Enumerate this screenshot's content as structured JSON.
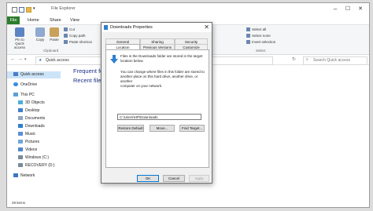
{
  "window": {
    "title": "File Explorer",
    "min": "–",
    "max": "☐",
    "close": "✕"
  },
  "tabs": [
    "File",
    "Home",
    "Share",
    "View"
  ],
  "ribbon": {
    "pin": "Pin to Quick access",
    "copy": "Copy",
    "paste": "Paste",
    "cut": "Cut",
    "copy_path": "Copy path",
    "paste_shortcut": "Paste shortcut",
    "clipboard_group": "Clipboard",
    "select_all": "Select all",
    "select_none": "Select none",
    "invert_selection": "Invert selection",
    "select_group": "Select"
  },
  "address": {
    "path": "Quick access",
    "search_placeholder": "Search Quick access"
  },
  "sidebar": {
    "items": [
      "Quick access",
      "OneDrive",
      "This PC",
      "3D Objects",
      "Desktop",
      "Documents",
      "Downloads",
      "Music",
      "Pictures",
      "Videos",
      "Windows (C:)",
      "RECOVERY (D:)",
      "Network"
    ]
  },
  "content": {
    "frequent": "Frequent folders",
    "recent": "Recent files (20)"
  },
  "status": {
    "count": "29 items"
  },
  "dialog": {
    "title": "Downloads Properties",
    "tabs_row1": [
      "General",
      "Sharing",
      "Security"
    ],
    "tabs_row2": [
      "Location",
      "Previous Versions",
      "Customize"
    ],
    "info1": [
      "Files in the Downloads folder are stored in the target",
      "location below."
    ],
    "info2": [
      "You can change where files in this folder are stored to",
      "another place on this hard drive, another drive, or another",
      "computer on your network."
    ],
    "path": "C:\\Users\\HP\\Downloads",
    "restore": "Restore Default",
    "move": "Move...",
    "find": "Find Target...",
    "ok": "OK",
    "cancel": "Cancel",
    "apply": "Apply"
  },
  "colors": {
    "file_tab": "#2b7d2b",
    "selection": "#cce4f7",
    "accent": "#0078d7",
    "folder": "#e8b84a",
    "section_text": "#1e3287"
  }
}
